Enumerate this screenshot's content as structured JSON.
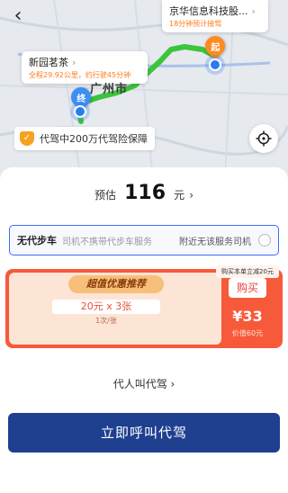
{
  "nav": {
    "back_icon": "chevron-left-icon"
  },
  "map": {
    "city_label": "广州市",
    "end_callout": {
      "title": "新园茗茶",
      "detail": "全程29.92公里，约行驶45分钟"
    },
    "start_callout": {
      "title": "京华信息科技股...",
      "detail": "18分钟预计接驾"
    },
    "start_pin_label": "起",
    "end_pin_label": "终",
    "insurance_text": "代驾中200万代驾险保障",
    "route_color": "#3cc43c"
  },
  "estimate": {
    "label": "预估",
    "amount": "116",
    "unit": "元",
    "chevron": "›"
  },
  "option": {
    "name": "无代步车",
    "description": "司机不携带代步车服务",
    "status": "附近无该服务司机"
  },
  "promo": {
    "title": "超值优惠推荐",
    "coupon": "20元 x 3张",
    "limit": "1次/张",
    "tip": "购买本单立减20元",
    "buy_label": "购买",
    "price": "¥33",
    "original_price": "价值60元"
  },
  "others_link": "代人叫代驾 ›",
  "call_button": "立即呼叫代驾",
  "colors": {
    "accent": "#1f3f8f",
    "promo": "#f75a3a",
    "start": "#ff8a1f",
    "end": "#3d8ef5"
  }
}
